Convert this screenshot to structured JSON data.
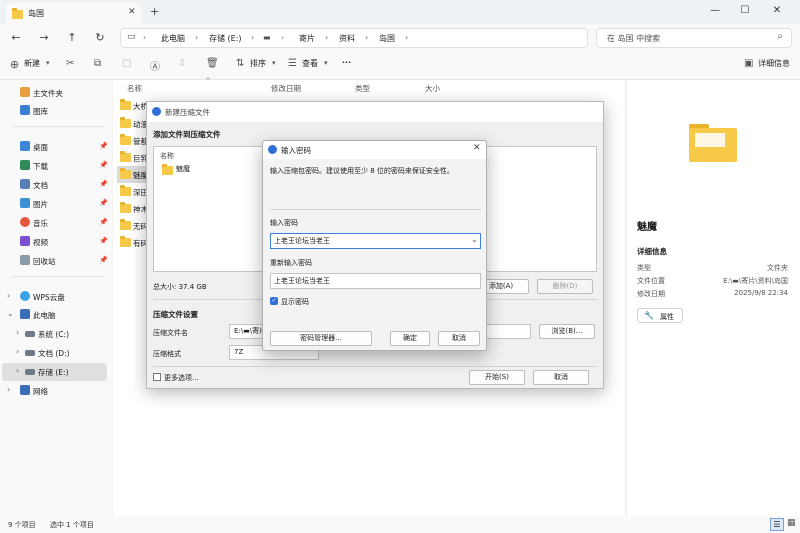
{
  "window": {
    "tab_title": "岛国",
    "new_tab": "+",
    "minimize": "—",
    "maximize": "☐",
    "close": "✕"
  },
  "address": {
    "crumbs": [
      "此电脑",
      "存储 (E:)",
      "▬",
      "寄片",
      "资料",
      "岛国"
    ],
    "separator": "›",
    "search_placeholder": "在 岛国 中搜索"
  },
  "toolbar": {
    "new_label": "新建",
    "sort_label": "排序",
    "view_label": "查看",
    "more_label": "···",
    "details_label": "详细信息"
  },
  "sidebar": {
    "quick": [
      {
        "label": "主文件夹",
        "color": "#e79e3c"
      },
      {
        "label": "图库",
        "color": "#3b7fd4"
      }
    ],
    "pinned": [
      {
        "label": "桌面",
        "color": "#3a86d9"
      },
      {
        "label": "下载",
        "color": "#2e8b57"
      },
      {
        "label": "文档",
        "color": "#5a7fb5"
      },
      {
        "label": "图片",
        "color": "#3d8fd6"
      },
      {
        "label": "音乐",
        "color": "#e4573b"
      },
      {
        "label": "视频",
        "color": "#7b4fcf"
      },
      {
        "label": "回收站",
        "color": "#8a9aa8"
      }
    ],
    "tree": [
      {
        "label": "WPS云盘",
        "color": "#3aa0e8",
        "indent": 0
      },
      {
        "label": "此电脑",
        "color": "#3a6fb5",
        "indent": 0
      },
      {
        "label": "系统 (C:)",
        "color": "#6f7a86",
        "indent": 1
      },
      {
        "label": "文档 (D:)",
        "color": "#6f7a86",
        "indent": 1
      },
      {
        "label": "存储 (E:)",
        "color": "#6f7a86",
        "indent": 1
      },
      {
        "label": "网络",
        "color": "#3a6fb5",
        "indent": 0
      }
    ]
  },
  "filelist": {
    "columns": [
      "名称",
      "修改日期",
      "类型",
      "大小"
    ],
    "items": [
      "大桥",
      "动漫",
      "管都",
      "巨乳",
      "魅魔",
      "深田",
      "神木",
      "无码",
      "有码"
    ]
  },
  "details": {
    "name": "魅魔",
    "section": "详细信息",
    "rows": [
      {
        "key": "类型",
        "value": "文件夹"
      },
      {
        "key": "文件位置",
        "value": "E:\\▬\\寄片\\资料\\岛国"
      },
      {
        "key": "修改日期",
        "value": "2025/9/8 22:34"
      }
    ],
    "properties_button": "属性"
  },
  "status": {
    "count": "9 个项目",
    "selected": "选中 1 个项目"
  },
  "archive_dialog": {
    "title": "新建压缩文件",
    "section_add": "添加文件到压缩文件",
    "list_header": "名称",
    "list_item": "魅魔",
    "total_size": "总大小: 37.4 GB",
    "add_button": "添加(A)",
    "delete_button": "删除(D)",
    "section_settings": "压缩文件设置",
    "name_label": "压缩文件名",
    "name_value": "E:\\▬\\寄片",
    "browse_button": "浏览(B)...",
    "format_label": "压缩格式",
    "format_value": "7Z",
    "more_options": "更多选项...",
    "start_button": "开始(S)",
    "cancel_button": "取消"
  },
  "password_dialog": {
    "title": "输入密码",
    "description": "输入压缩包密码。建议使用至少 8 位的密码来保证安全性。",
    "password_label": "输入密码",
    "password_value": "上老王论坛当老王",
    "confirm_label": "重新输入密码",
    "confirm_value": "上老王论坛当老王",
    "show_password": "显示密码",
    "manager_button": "密码管理器...",
    "ok_button": "确定",
    "cancel_button": "取消"
  }
}
